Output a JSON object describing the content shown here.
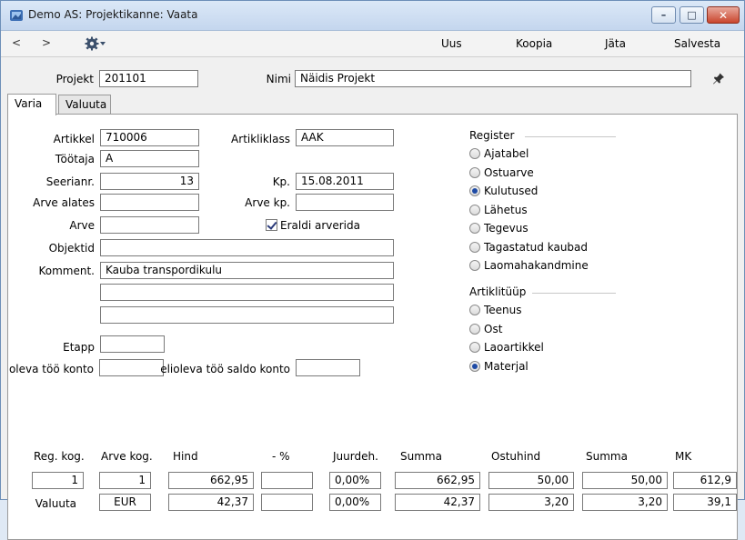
{
  "window": {
    "title": "Demo AS: Projektikanne: Vaata",
    "minimize": "–",
    "maximize": "□",
    "close": "✕"
  },
  "toolbar": {
    "back": "<",
    "forward": ">",
    "new": "Uus",
    "copy": "Koopia",
    "skip": "Jäta",
    "save": "Salvesta"
  },
  "header": {
    "project_label": "Projekt",
    "project_value": "201101",
    "name_label": "Nimi",
    "name_value": "Näidis Projekt"
  },
  "tabs": [
    "Varia",
    "Valuuta"
  ],
  "form": {
    "item_label": "Artikkel",
    "item_value": "710006",
    "item_class_label": "Artikliklass",
    "item_class_value": "AAK",
    "worker_label": "Töötaja",
    "worker_value": "A",
    "serial_label": "Seerianr.",
    "serial_value": "13",
    "date_label": "Kp.",
    "date_value": "15.08.2011",
    "invoice_from_label": "Arve alates",
    "invoice_from_value": "",
    "invoice_date_label": "Arve kp.",
    "invoice_date_value": "",
    "invoice_label": "Arve",
    "invoice_value": "",
    "separate_invoice_label": "Eraldi arverida",
    "separate_invoice_checked": true,
    "objects_label": "Objektid",
    "objects_value": "",
    "comment_label": "Komment.",
    "comment_lines": [
      "Kauba transpordikulu",
      "",
      ""
    ],
    "stage_label": "Etapp",
    "stage_value": "",
    "wip_account_label": "oleva töö konto",
    "wip_account_value": "",
    "wip_balance_label": "elioleva töö saldo konto",
    "wip_balance_value": ""
  },
  "register": {
    "title": "Register",
    "options": [
      "Ajatabel",
      "Ostuarve",
      "Kulutused",
      "Lähetus",
      "Tegevus",
      "Tagastatud kaubad",
      "Laomahakandmine"
    ],
    "selected": "Kulutused"
  },
  "item_type": {
    "title": "Artiklitüüp",
    "options": [
      "Teenus",
      "Ost",
      "Laoartikkel",
      "Materjal"
    ],
    "selected": "Materjal"
  },
  "grid": {
    "headers": [
      "Reg. kog.",
      "Arve kog.",
      "Hind",
      "- %",
      "Juurdeh.",
      "Summa",
      "Ostuhind",
      "Summa",
      "MK"
    ],
    "row1": [
      "1",
      "1",
      "662,95",
      "",
      "0,00%",
      "662,95",
      "50,00",
      "50,00",
      "612,9"
    ],
    "row2_label": "Valuuta",
    "row2": [
      "EUR",
      "42,37",
      "",
      "0,00%",
      "42,37",
      "3,20",
      "3,20",
      "39,1"
    ]
  }
}
